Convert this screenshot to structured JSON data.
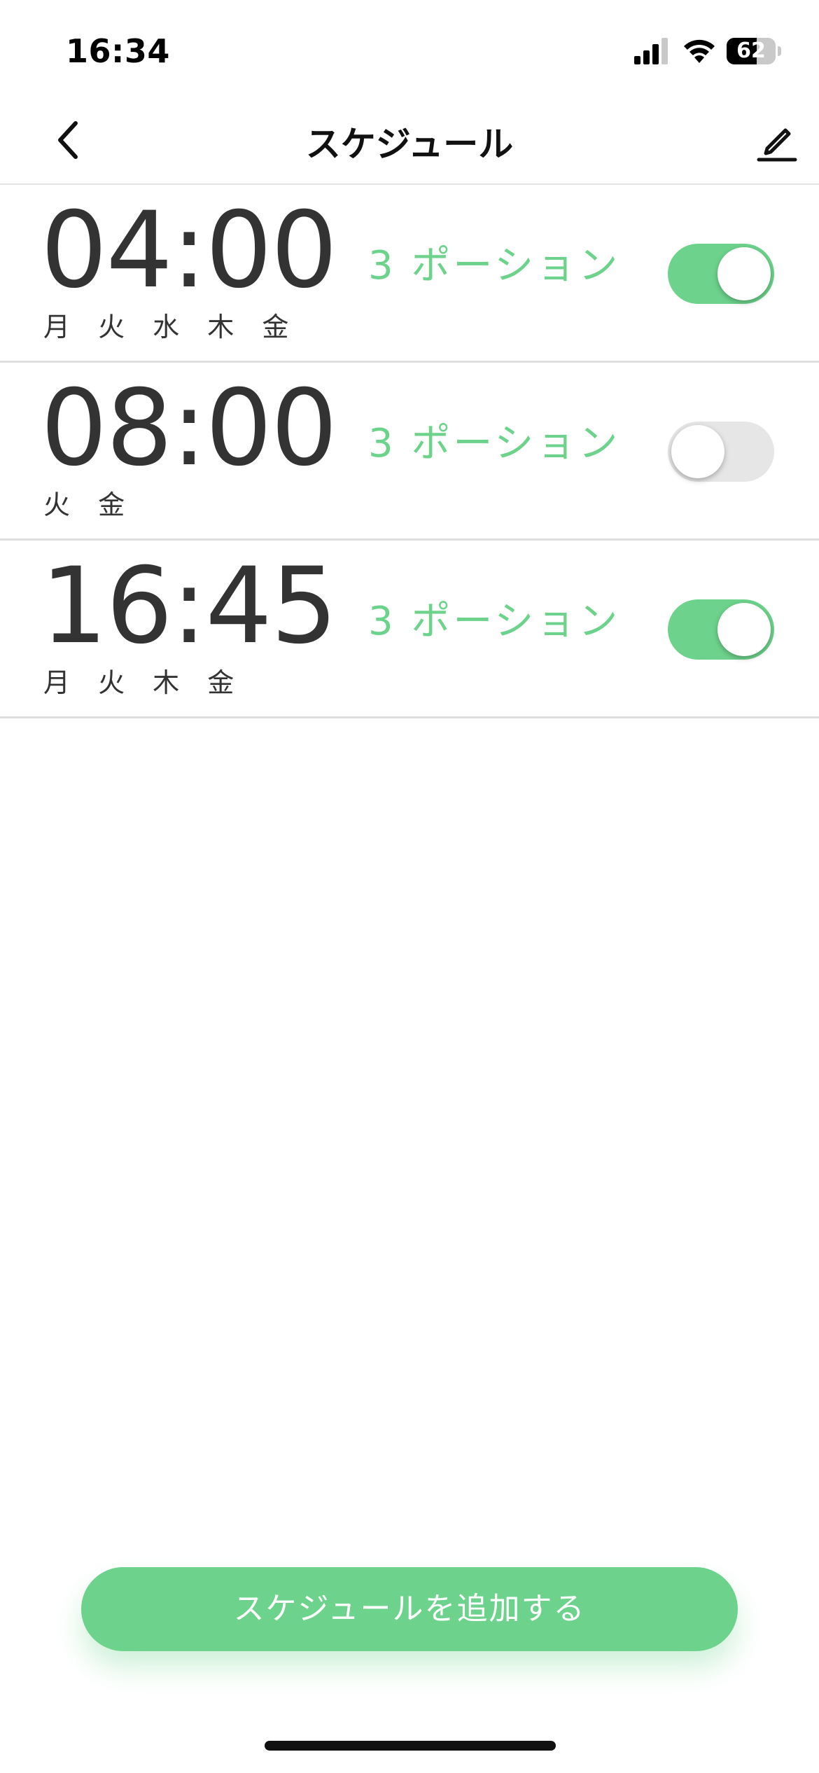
{
  "status_bar": {
    "time": "16:34",
    "battery_level": "62",
    "battery_fraction": 0.62,
    "icons": [
      "signal-icon",
      "wifi-icon",
      "battery-icon"
    ]
  },
  "nav": {
    "title": "スケジュール",
    "back_icon": "chevron-left-icon",
    "edit_icon": "pencil-icon"
  },
  "schedules": [
    {
      "time": "04:00",
      "portions": "3 ポーション",
      "days": "月 火 水 木 金",
      "enabled": true
    },
    {
      "time": "08:00",
      "portions": "3 ポーション",
      "days": "火 金",
      "enabled": false
    },
    {
      "time": "16:45",
      "portions": "3 ポーション",
      "days": "月 火 木 金",
      "enabled": true
    }
  ],
  "add_button": {
    "label": "スケジュールを追加する"
  },
  "colors": {
    "accent": "#6dd38c",
    "toggle_off": "#e6e6e6",
    "text": "#333333",
    "divider": "#dedede"
  }
}
